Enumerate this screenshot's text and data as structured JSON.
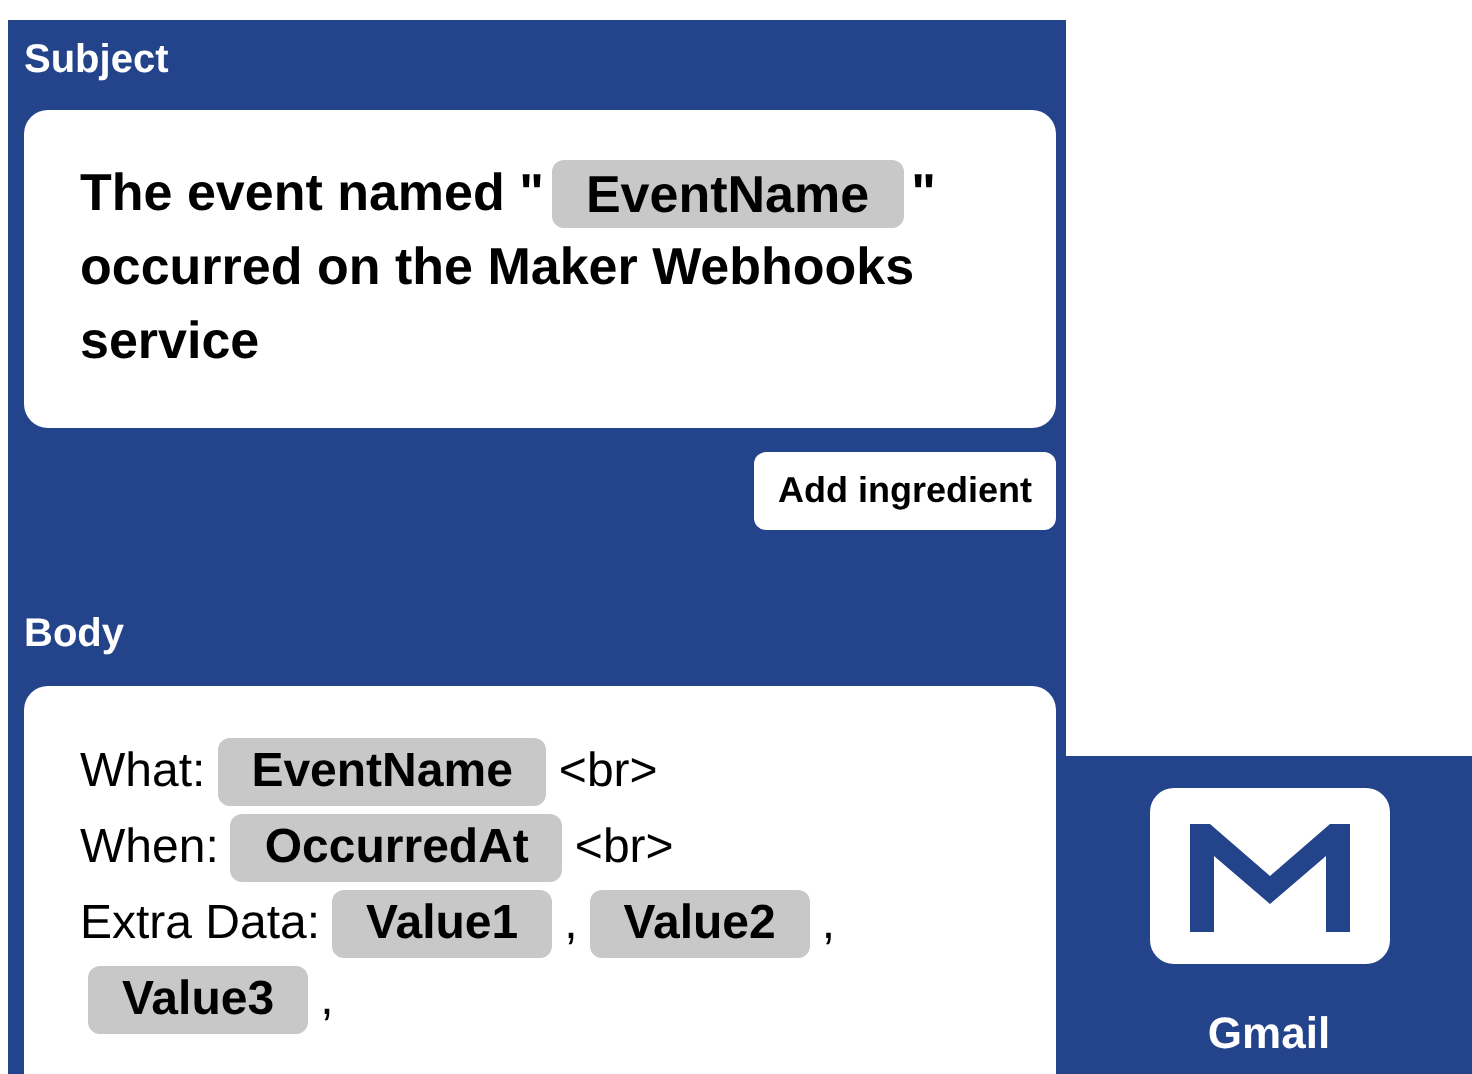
{
  "subject": {
    "label": "Subject",
    "lines": [
      [
        {
          "kind": "text",
          "text": "The event named \""
        },
        {
          "kind": "ingredient",
          "text": "EventName"
        },
        {
          "kind": "text",
          "text": "\""
        }
      ],
      [
        {
          "kind": "text",
          "text": "occurred on the Maker Webhooks service"
        }
      ]
    ],
    "button": "Add ingredient"
  },
  "body": {
    "label": "Body",
    "lines": [
      [
        {
          "kind": "text",
          "text": "What:"
        },
        {
          "kind": "ingredient",
          "text": "EventName"
        },
        {
          "kind": "text",
          "text": "<br>"
        }
      ],
      [
        {
          "kind": "text",
          "text": "When:"
        },
        {
          "kind": "ingredient",
          "text": "OccurredAt"
        },
        {
          "kind": "text",
          "text": "<br>"
        }
      ],
      [
        {
          "kind": "text",
          "text": "Extra Data:"
        },
        {
          "kind": "ingredient",
          "text": "Value1"
        },
        {
          "kind": "text",
          "text": ","
        },
        {
          "kind": "ingredient",
          "text": "Value2"
        },
        {
          "kind": "text",
          "text": ","
        },
        {
          "kind": "ingredient",
          "text": "Value3"
        },
        {
          "kind": "text",
          "text": ","
        }
      ]
    ]
  },
  "service": {
    "name": "Gmail"
  }
}
